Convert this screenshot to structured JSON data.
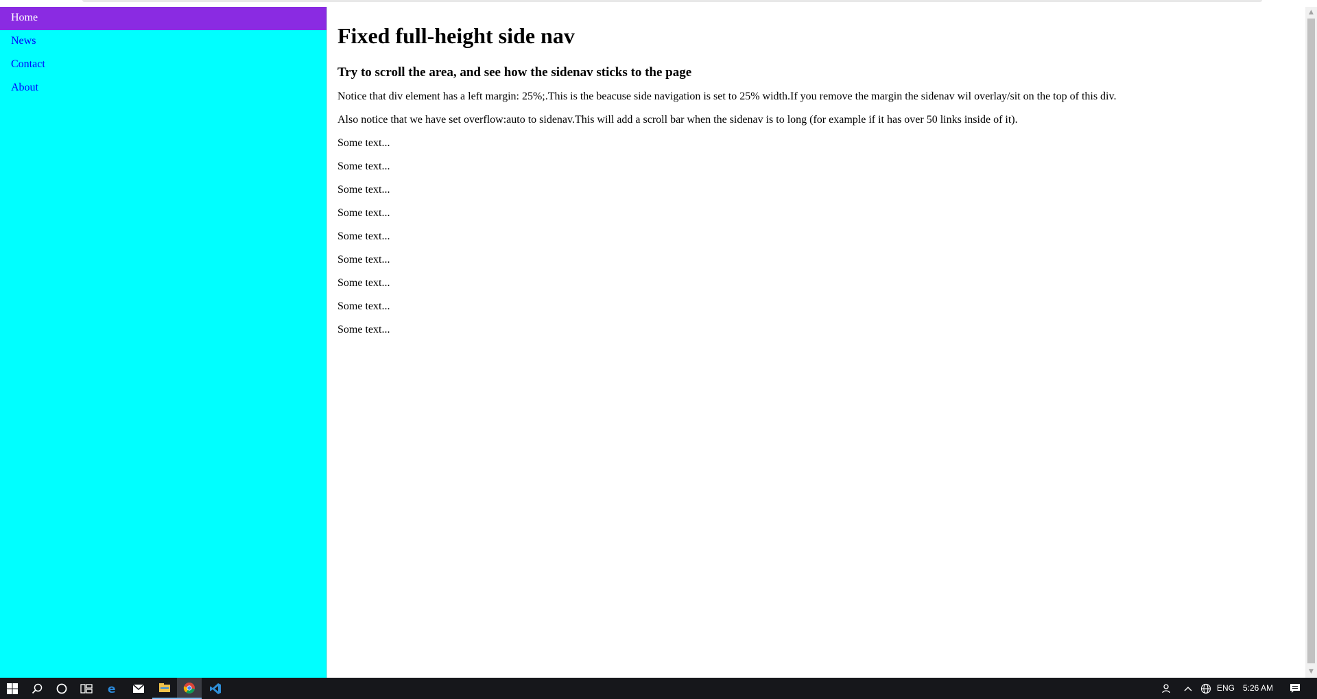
{
  "sidenav": {
    "items": [
      {
        "label": "Home",
        "active": true
      },
      {
        "label": "News",
        "active": false
      },
      {
        "label": "Contact",
        "active": false
      },
      {
        "label": "About",
        "active": false
      }
    ]
  },
  "main": {
    "title": "Fixed full-height side nav",
    "subtitle": "Try to scroll the area, and see how the sidenav sticks to the page",
    "paragraphs": [
      "Notice that div element has a left margin: 25%;.This is the beacuse side navigation is set to 25% width.If you remove the margin the sidenav wil overlay/sit on the top of this div.",
      "Also notice that we have set overflow:auto to sidenav.This will add a scroll bar when the sidenav is to long (for example if it has over 50 links inside of it).",
      "Some text...",
      "Some text...",
      "Some text...",
      "Some text...",
      "Some text...",
      "Some text...",
      "Some text...",
      "Some text...",
      "Some text..."
    ]
  },
  "colors": {
    "sidenav_bg": "#00ffff",
    "active_item_bg": "#8a2be2",
    "link": "#0000ff"
  },
  "taskbar": {
    "icons": [
      "windows-start-icon",
      "search-icon",
      "cortana-icon",
      "task-view-icon",
      "edge-icon",
      "mail-icon",
      "file-explorer-icon",
      "chrome-icon",
      "vscode-icon"
    ],
    "tray": {
      "language": "ENG",
      "time": "5:26 AM"
    }
  }
}
